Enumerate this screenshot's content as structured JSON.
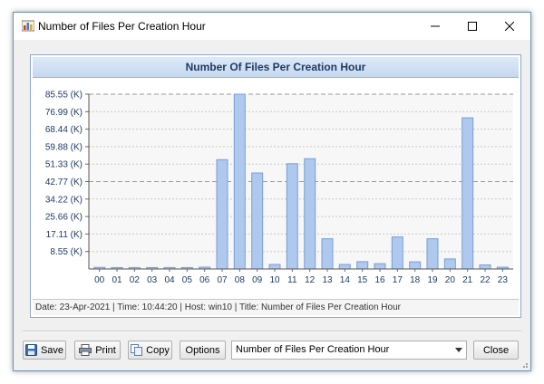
{
  "window": {
    "title": "Number of Files Per Creation Hour"
  },
  "chart": {
    "heading": "Number Of Files Per Creation Hour"
  },
  "chart_data": {
    "type": "bar",
    "title": "Number Of Files Per Creation Hour",
    "xlabel": "",
    "ylabel": "",
    "categories": [
      "00",
      "01",
      "02",
      "03",
      "04",
      "05",
      "06",
      "07",
      "08",
      "09",
      "10",
      "11",
      "12",
      "13",
      "14",
      "15",
      "16",
      "17",
      "18",
      "19",
      "20",
      "21",
      "22",
      "23"
    ],
    "values": [
      0.8,
      0.7,
      0.7,
      0.7,
      0.7,
      0.7,
      0.9,
      53.5,
      85.55,
      47.0,
      2.2,
      51.5,
      54.0,
      14.8,
      2.2,
      3.6,
      2.6,
      15.7,
      3.5,
      14.8,
      4.9,
      74.0,
      2.0,
      0.9
    ],
    "yticks": [
      "8.55 (K)",
      "17.11 (K)",
      "25.66 (K)",
      "34.22 (K)",
      "42.77 (K)",
      "51.33 (K)",
      "59.88 (K)",
      "68.44 (K)",
      "76.99 (K)",
      "85.55 (K)"
    ],
    "ylim": [
      0,
      85.55
    ],
    "units": "K",
    "grid": true,
    "legend": "none",
    "bar_color": "#aec8ee",
    "bar_border": "#7a9ed6",
    "grid_color": "#c9c9c9",
    "reference_line_color": "#9a9a9a"
  },
  "status": {
    "text": "Date: 23-Apr-2021 | Time: 10:44:20 | Host: win10 | Title: Number of Files Per Creation Hour"
  },
  "toolbar": {
    "save_label": "Save",
    "print_label": "Print",
    "copy_label": "Copy",
    "options_label": "Options",
    "chart_select_value": "Number of Files Per Creation Hour",
    "close_label": "Close"
  },
  "icons": {
    "app": "chart-icon",
    "minimize": "minimize-icon",
    "maximize": "maximize-icon",
    "close": "close-icon",
    "save": "floppy-disk-icon",
    "print": "printer-icon",
    "copy": "copy-icon"
  }
}
